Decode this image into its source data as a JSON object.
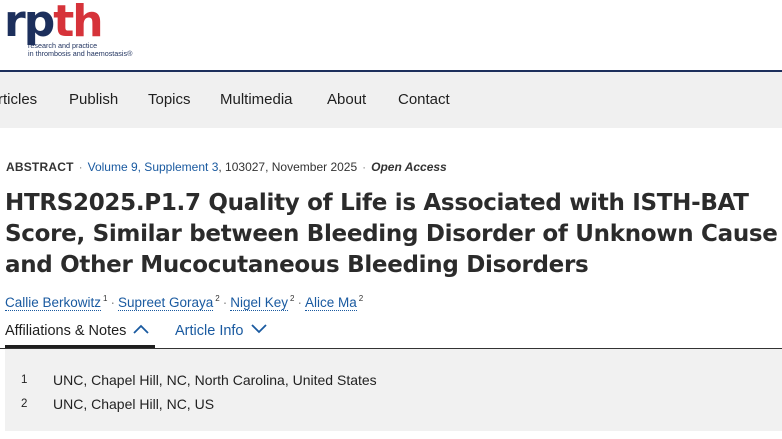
{
  "logo": {
    "word_r": "r",
    "word_p": "p",
    "word_t": "t",
    "word_h": "h",
    "sub_line1": "research and practice",
    "sub_line2": "in thrombosis and haemostasis®"
  },
  "nav": {
    "items": [
      "rticles",
      "Publish",
      "Topics",
      "Multimedia",
      "About",
      "Contact"
    ]
  },
  "meta": {
    "type": "ABSTRACT",
    "volume": "Volume 9, Supplement 3",
    "article_no": ", 103027, November 2025",
    "access": "Open Access"
  },
  "title": "HTRS2025.P1.7 Quality of Life is Associated with ISTH-BAT Score, Similar between Bleeding Disorder of Unknown Cause and Other Mucocutaneous Bleeding Disorders",
  "authors": [
    {
      "name": "Callie Berkowitz",
      "aff": "1"
    },
    {
      "name": "Supreet Goraya",
      "aff": "2"
    },
    {
      "name": "Nigel Key",
      "aff": "2"
    },
    {
      "name": "Alice Ma",
      "aff": "2"
    }
  ],
  "tabs": {
    "affiliations": "Affiliations & Notes",
    "article_info": "Article Info"
  },
  "affiliations": [
    {
      "num": "1",
      "text": "UNC, Chapel Hill, NC, North Carolina, United States"
    },
    {
      "num": "2",
      "text": "UNC, Chapel Hill, NC, US"
    }
  ],
  "colors": {
    "brand_navy": "#1c2f5c",
    "brand_red": "#d6333a",
    "link_blue": "#1a5aa0"
  }
}
